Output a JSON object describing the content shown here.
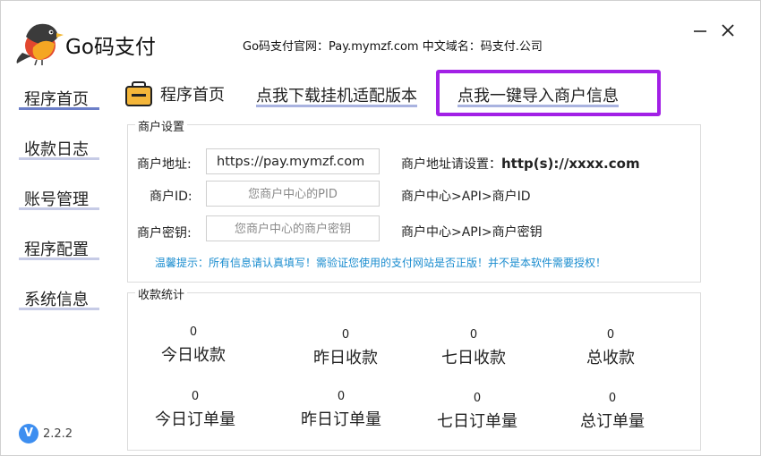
{
  "app": {
    "title": "Go码支付",
    "site_info": "Go码支付官网：Pay.mymzf.com 中文域名：码支付.公司",
    "version": "2.2.2",
    "version_badge": "V"
  },
  "sidebar": {
    "items": [
      {
        "label": "程序首页",
        "active": true
      },
      {
        "label": "收款日志",
        "active": false
      },
      {
        "label": "账号管理",
        "active": false
      },
      {
        "label": "程序配置",
        "active": false
      },
      {
        "label": "系统信息",
        "active": false
      }
    ]
  },
  "tabs": {
    "home": "程序首页",
    "download": "点我下载挂机适配版本",
    "import": "点我一键导入商户信息"
  },
  "merchant": {
    "group_title": "商户设置",
    "address_label": "商户地址:",
    "address_value": "https://pay.mymzf.com",
    "address_hint_prefix": "商户地址请设置：",
    "address_hint_strong": "http(s)://xxxx.com",
    "id_label": "商户ID:",
    "id_placeholder": "您商户中心的PID",
    "id_hint": "商户中心>API>商户ID",
    "key_label": "商户密钥:",
    "key_placeholder": "您商户中心的商户密钥",
    "key_hint": "商户中心>API>商户密钥",
    "notice": "温馨提示：所有信息请认真填写！需验证您使用的支付网站是否正版！并不是本软件需要授权！"
  },
  "stats": {
    "group_title": "收款统计",
    "items": [
      {
        "label": "今日收款",
        "value": "0"
      },
      {
        "label": "昨日收款",
        "value": "0"
      },
      {
        "label": "七日收款",
        "value": "0"
      },
      {
        "label": "总收款",
        "value": "0"
      },
      {
        "label": "今日订单量",
        "value": "0"
      },
      {
        "label": "昨日订单量",
        "value": "0"
      },
      {
        "label": "七日订单量",
        "value": "0"
      },
      {
        "label": "总订单量",
        "value": "0"
      }
    ]
  },
  "colors": {
    "accent_frame": "#a220e6",
    "notice_text": "#1a8ccf",
    "active_underline": "#6c7fc8",
    "version_badge": "#3d8ef0"
  },
  "icons": {
    "logo": "bird-logo-icon",
    "minimize": "minimize-icon",
    "close": "close-icon",
    "home_tab": "briefcase-icon"
  }
}
